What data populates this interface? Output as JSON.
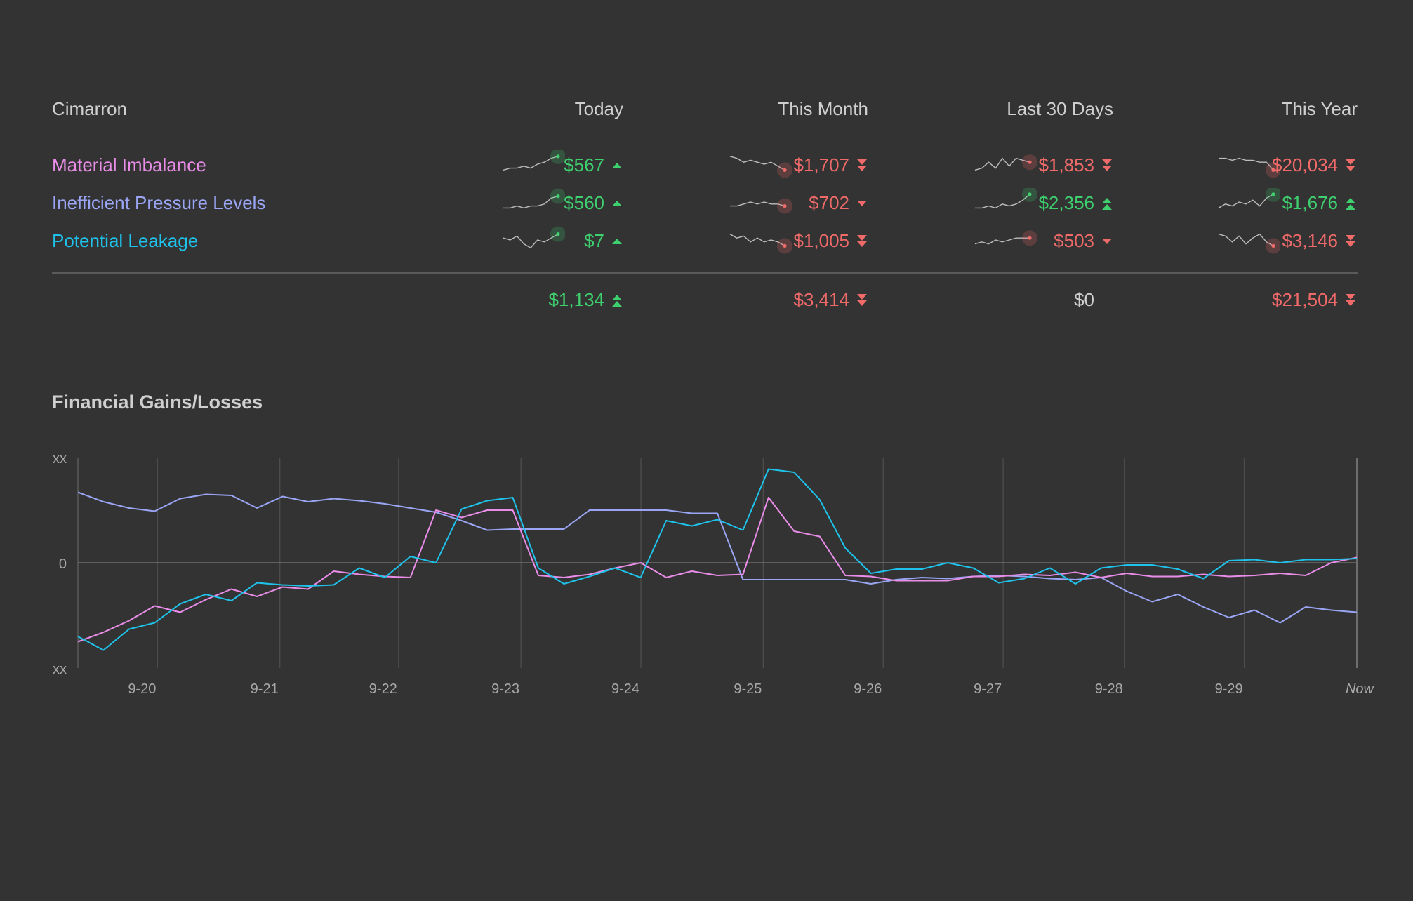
{
  "header": {
    "group_label": "Cimarron",
    "columns": [
      "Today",
      "This Month",
      "Last 30 Days",
      "This Year"
    ]
  },
  "colors": {
    "positive": "#3ecf6e",
    "negative": "#f06a6a",
    "neutral": "#cfcfcf",
    "series_material": "#e98de8",
    "series_pressure": "#9aa6f5",
    "series_leakage": "#1ec2ea"
  },
  "rows": [
    {
      "label": "Material Imbalance",
      "color": "#e98de8",
      "cells": [
        {
          "value": "$567",
          "trend": "up",
          "icon": "triangle-up-icon",
          "spark": [
            2,
            3,
            3,
            4,
            3,
            5,
            6,
            8,
            9
          ]
        },
        {
          "value": "$1,707",
          "trend": "down-strong",
          "icon": "double-chevron-down-icon",
          "spark": [
            9,
            8,
            6,
            7,
            6,
            5,
            6,
            4,
            2
          ]
        },
        {
          "value": "$1,853",
          "trend": "down-strong",
          "icon": "double-chevron-down-icon",
          "spark": [
            2,
            3,
            6,
            3,
            8,
            4,
            8,
            7,
            6
          ]
        },
        {
          "value": "$20,034",
          "trend": "down-strong",
          "icon": "double-chevron-down-icon",
          "spark": [
            8,
            8,
            7,
            8,
            7,
            7,
            6,
            6,
            2
          ]
        }
      ]
    },
    {
      "label": "Inefficient Pressure Levels",
      "color": "#9aa6f5",
      "cells": [
        {
          "value": "$560",
          "trend": "up",
          "icon": "triangle-up-icon",
          "spark": [
            2,
            2,
            3,
            2,
            3,
            3,
            4,
            7,
            8
          ]
        },
        {
          "value": "$702",
          "trend": "down",
          "icon": "triangle-down-icon",
          "spark": [
            3,
            3,
            4,
            5,
            4,
            5,
            4,
            4,
            3
          ]
        },
        {
          "value": "$2,356",
          "trend": "up-strong",
          "icon": "double-chevron-up-icon",
          "spark": [
            2,
            2,
            3,
            2,
            4,
            3,
            4,
            6,
            9
          ]
        },
        {
          "value": "$1,676",
          "trend": "up-strong",
          "icon": "double-chevron-up-icon",
          "spark": [
            2,
            4,
            3,
            5,
            4,
            6,
            3,
            7,
            9
          ]
        }
      ]
    },
    {
      "label": "Potential Leakage",
      "color": "#1ec2ea",
      "cells": [
        {
          "value": "$7",
          "trend": "up",
          "icon": "triangle-up-icon",
          "spark": [
            6,
            5,
            7,
            3,
            1,
            5,
            4,
            6,
            8
          ]
        },
        {
          "value": "$1,005",
          "trend": "down-strong",
          "icon": "double-chevron-down-icon",
          "spark": [
            8,
            6,
            7,
            4,
            6,
            4,
            5,
            4,
            2
          ]
        },
        {
          "value": "$503",
          "trend": "down",
          "icon": "triangle-down-icon",
          "spark": [
            3,
            4,
            3,
            5,
            4,
            5,
            6,
            6,
            6
          ]
        },
        {
          "value": "$3,146",
          "trend": "down-strong",
          "icon": "double-chevron-down-icon",
          "spark": [
            8,
            7,
            4,
            7,
            3,
            6,
            8,
            4,
            2
          ]
        }
      ]
    }
  ],
  "totals": [
    {
      "value": "$1,134",
      "trend": "up-strong",
      "icon": "double-chevron-up-icon"
    },
    {
      "value": "$3,414",
      "trend": "down-strong",
      "icon": "double-chevron-down-icon"
    },
    {
      "value": "$0",
      "trend": "neutral",
      "icon": ""
    },
    {
      "value": "$21,504",
      "trend": "down-strong",
      "icon": "double-chevron-down-icon"
    }
  ],
  "chart_title": "Financial Gains/Losses",
  "chart_data": {
    "type": "line",
    "title": "Financial Gains/Losses",
    "xlabel": "",
    "ylabel": "",
    "x_tick_labels": [
      "9-20",
      "9-21",
      "9-22",
      "9-23",
      "9-24",
      "9-25",
      "9-26",
      "9-27",
      "9-28",
      "9-29",
      "Now"
    ],
    "y_tick_labels": [
      "xx",
      "0",
      "xx"
    ],
    "ylim": [
      -1,
      1
    ],
    "x_range_days": [
      0,
      10.45
    ],
    "grid": true,
    "legend": "none",
    "series": [
      {
        "color": "#9aa6f5",
        "x": [
          0,
          0.2,
          0.4,
          0.6,
          0.8,
          1.0,
          1.2,
          1.4,
          1.6,
          1.8,
          2.0,
          2.2,
          2.4,
          2.6,
          2.8,
          3.0,
          3.2,
          3.4,
          3.6,
          3.8,
          4.0,
          4.2,
          4.4,
          4.6,
          4.8,
          5.0,
          5.2,
          5.4,
          5.6,
          5.8,
          6.0,
          6.2,
          6.4,
          6.6,
          6.8,
          7.0,
          7.2,
          7.4,
          7.6,
          7.8,
          8.0,
          8.2,
          8.4,
          8.6,
          8.8,
          9.0,
          9.2,
          9.4,
          9.6,
          9.8,
          10.0
        ],
        "y": [
          0.67,
          0.58,
          0.52,
          0.49,
          0.61,
          0.65,
          0.64,
          0.52,
          0.63,
          0.58,
          0.61,
          0.59,
          0.56,
          0.52,
          0.48,
          0.4,
          0.31,
          0.32,
          0.32,
          0.32,
          0.5,
          0.5,
          0.5,
          0.5,
          0.47,
          0.47,
          -0.16,
          -0.16,
          -0.16,
          -0.16,
          -0.16,
          -0.2,
          -0.16,
          -0.14,
          -0.15,
          -0.13,
          -0.12,
          -0.13,
          -0.15,
          -0.16,
          -0.14,
          -0.27,
          -0.37,
          -0.3,
          -0.42,
          -0.52,
          -0.45,
          -0.57,
          -0.42,
          -0.45,
          -0.47
        ]
      },
      {
        "color": "#e98de8",
        "x": [
          0,
          0.2,
          0.4,
          0.6,
          0.8,
          1.0,
          1.2,
          1.4,
          1.6,
          1.8,
          2.0,
          2.2,
          2.4,
          2.6,
          2.8,
          3.0,
          3.2,
          3.4,
          3.6,
          3.8,
          4.0,
          4.2,
          4.4,
          4.6,
          4.8,
          5.0,
          5.2,
          5.4,
          5.6,
          5.8,
          6.0,
          6.2,
          6.4,
          6.6,
          6.8,
          7.0,
          7.2,
          7.4,
          7.6,
          7.8,
          8.0,
          8.2,
          8.4,
          8.6,
          8.8,
          9.0,
          9.2,
          9.4,
          9.6,
          9.8,
          10.0
        ],
        "y": [
          -0.75,
          -0.66,
          -0.55,
          -0.41,
          -0.47,
          -0.35,
          -0.25,
          -0.32,
          -0.23,
          -0.25,
          -0.08,
          -0.11,
          -0.13,
          -0.14,
          0.5,
          0.43,
          0.5,
          0.5,
          -0.12,
          -0.14,
          -0.11,
          -0.05,
          0.0,
          -0.14,
          -0.08,
          -0.12,
          -0.11,
          0.62,
          0.3,
          0.25,
          -0.12,
          -0.13,
          -0.17,
          -0.17,
          -0.17,
          -0.13,
          -0.13,
          -0.11,
          -0.12,
          -0.09,
          -0.14,
          -0.1,
          -0.13,
          -0.13,
          -0.11,
          -0.13,
          -0.12,
          -0.1,
          -0.12,
          0.0,
          0.05
        ]
      },
      {
        "color": "#1ec2ea",
        "x": [
          0,
          0.2,
          0.4,
          0.6,
          0.8,
          1.0,
          1.2,
          1.4,
          1.6,
          1.8,
          2.0,
          2.2,
          2.4,
          2.6,
          2.8,
          3.0,
          3.2,
          3.4,
          3.6,
          3.8,
          4.0,
          4.2,
          4.4,
          4.6,
          4.8,
          5.0,
          5.2,
          5.4,
          5.6,
          5.8,
          6.0,
          6.2,
          6.4,
          6.6,
          6.8,
          7.0,
          7.2,
          7.4,
          7.6,
          7.8,
          8.0,
          8.2,
          8.4,
          8.6,
          8.8,
          9.0,
          9.2,
          9.4,
          9.6,
          9.8,
          10.0
        ],
        "y": [
          -0.7,
          -0.83,
          -0.63,
          -0.57,
          -0.39,
          -0.3,
          -0.36,
          -0.19,
          -0.21,
          -0.22,
          -0.21,
          -0.05,
          -0.14,
          0.06,
          0.0,
          0.51,
          0.59,
          0.62,
          -0.05,
          -0.2,
          -0.13,
          -0.05,
          -0.14,
          0.4,
          0.35,
          0.41,
          0.31,
          0.89,
          0.86,
          0.6,
          0.14,
          -0.1,
          -0.06,
          -0.06,
          0.0,
          -0.05,
          -0.19,
          -0.15,
          -0.05,
          -0.2,
          -0.05,
          -0.02,
          -0.02,
          -0.06,
          -0.15,
          0.02,
          0.03,
          0.0,
          0.03,
          0.03,
          0.04
        ]
      }
    ]
  }
}
